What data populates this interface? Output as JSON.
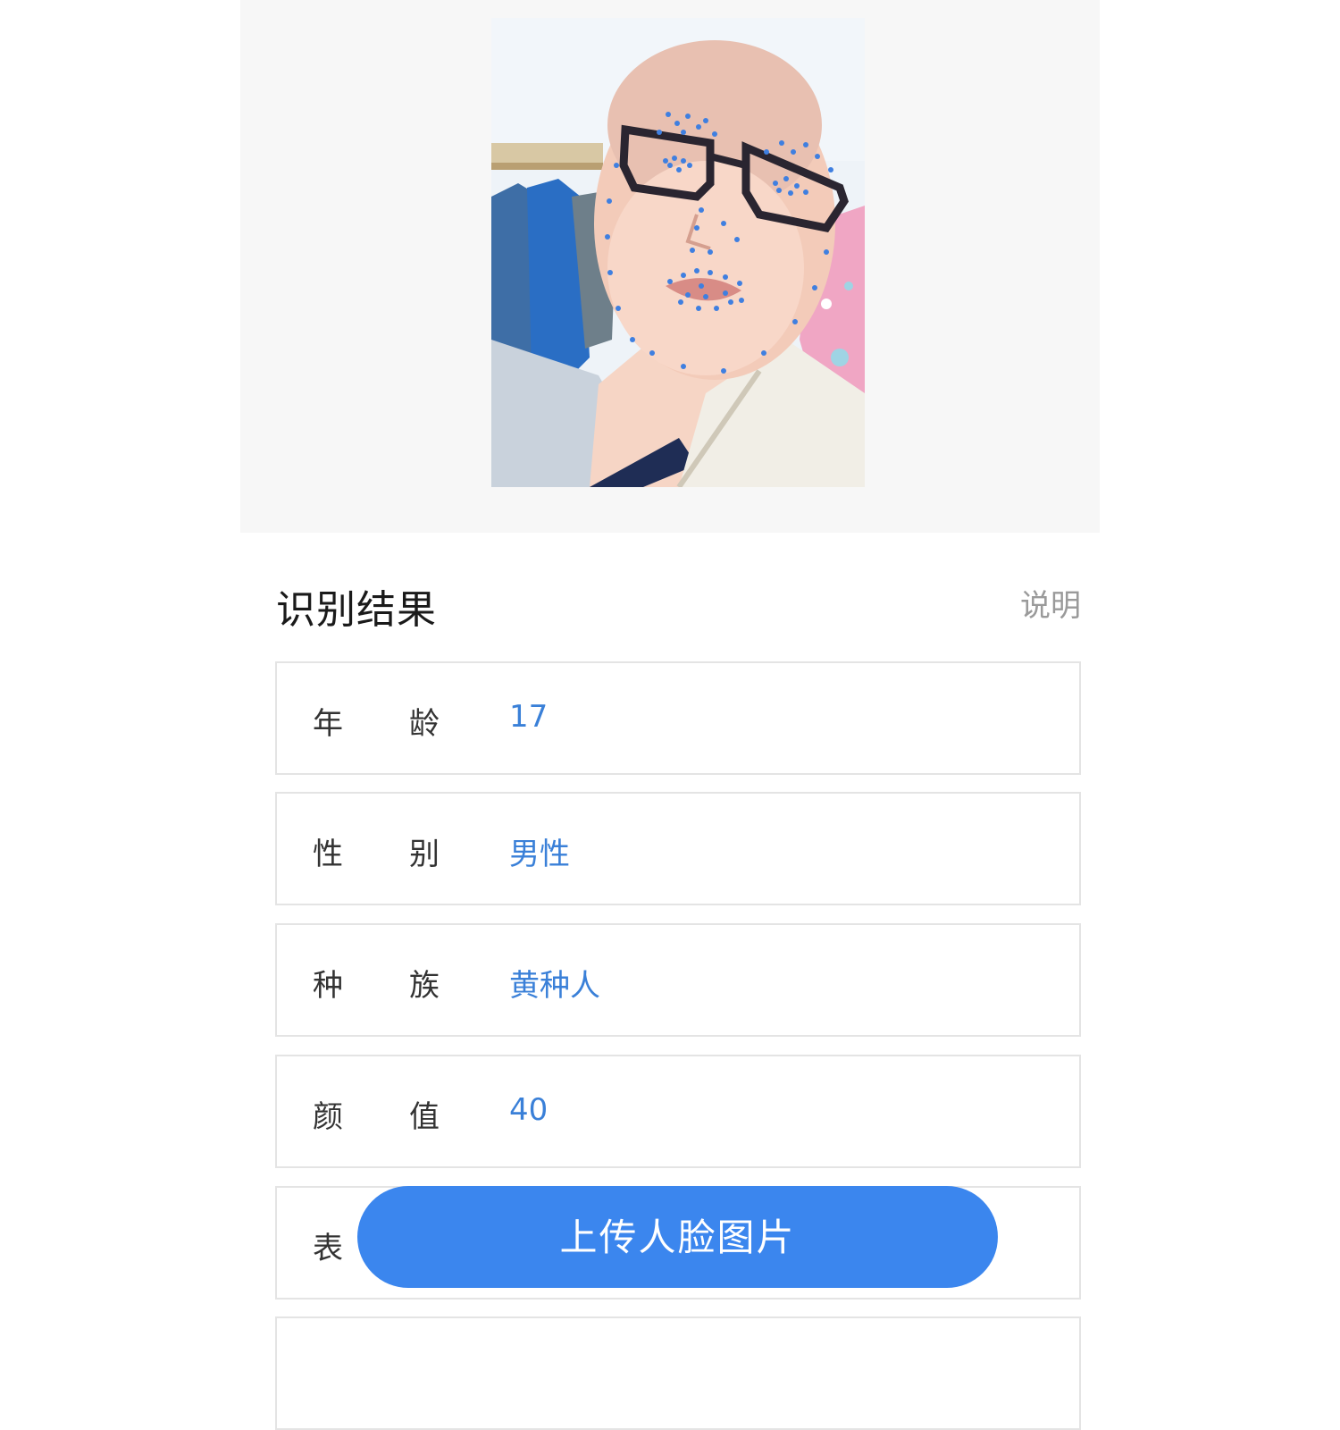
{
  "result": {
    "title": "识别结果",
    "explain_label": "说明"
  },
  "rows": [
    {
      "label_chars": [
        "年",
        "龄"
      ],
      "value": "17"
    },
    {
      "label_chars": [
        "性",
        "别"
      ],
      "value": "男性"
    },
    {
      "label_chars": [
        "种",
        "族"
      ],
      "value": "黄种人"
    },
    {
      "label_chars": [
        "颜",
        "值"
      ],
      "value": "40"
    },
    {
      "label_chars": [
        "表",
        ""
      ],
      "value": ""
    }
  ],
  "upload_button_label": "上传人脸图片",
  "colors": {
    "accent": "#3b86ee",
    "value_text": "#3a80d8",
    "landmark_dot": "#3f7fe0"
  },
  "icons": {
    "photo": "face-photo-with-landmarks"
  }
}
